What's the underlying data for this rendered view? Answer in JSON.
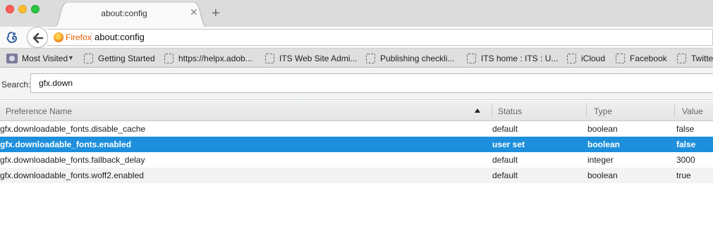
{
  "window": {
    "tab_title": "about:config",
    "tab_close_glyph": "✕",
    "new_tab_glyph": "+"
  },
  "nav": {
    "back_icon": "arrow-left-icon",
    "identity_label": "Firefox",
    "url": "about:config"
  },
  "bookmarks": [
    {
      "label": "Most Visited",
      "icon": "most-visited-icon",
      "dropdown": true
    },
    {
      "label": "Getting Started",
      "icon": "page-placeholder-icon"
    },
    {
      "label": "https://helpx.adob...",
      "icon": "page-placeholder-icon"
    },
    {
      "label": "ITS Web Site Admi...",
      "icon": "page-placeholder-icon"
    },
    {
      "label": "Publishing checkli...",
      "icon": "page-placeholder-icon"
    },
    {
      "label": "ITS home : ITS : U...",
      "icon": "page-placeholder-icon"
    },
    {
      "label": "iCloud",
      "icon": "page-placeholder-icon"
    },
    {
      "label": "Facebook",
      "icon": "page-placeholder-icon"
    },
    {
      "label": "Twitter",
      "icon": "page-placeholder-icon"
    }
  ],
  "search": {
    "label": "Search:",
    "value": "gfx.down"
  },
  "table": {
    "columns": [
      "Preference Name",
      "Status",
      "Type",
      "Value"
    ],
    "sort_column": "Preference Name",
    "sort_direction": "ascending",
    "rows": [
      {
        "name": "gfx.downloadable_fonts.disable_cache",
        "status": "default",
        "type": "boolean",
        "value": "false"
      },
      {
        "name": "gfx.downloadable_fonts.enabled",
        "status": "user set",
        "type": "boolean",
        "value": "false",
        "selected": true
      },
      {
        "name": "gfx.downloadable_fonts.fallback_delay",
        "status": "default",
        "type": "integer",
        "value": "3000"
      },
      {
        "name": "gfx.downloadable_fonts.woff2.enabled",
        "status": "default",
        "type": "boolean",
        "value": "true"
      }
    ]
  },
  "colors": {
    "selection": "#1d8fdc",
    "firefox_label": "#e66000",
    "close_button": "#fc5f57",
    "minimize_button": "#fdbc2e",
    "zoom_button": "#29c840"
  }
}
